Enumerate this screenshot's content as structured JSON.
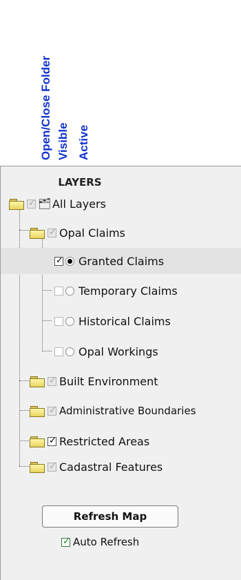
{
  "column_labels": [
    "Open/Close Folder",
    "Visible",
    "Active"
  ],
  "panel": {
    "title": "LAYERS",
    "all_layers": {
      "label": "All Layers",
      "visible": true,
      "visible_greyed": true
    },
    "groups": [
      {
        "label": "Opal Claims",
        "visible": true,
        "children": [
          {
            "label": "Granted Claims",
            "visible": true,
            "active": true,
            "highlighted": true
          },
          {
            "label": "Temporary Claims",
            "visible": false,
            "active": false
          },
          {
            "label": "Historical Claims",
            "visible": false,
            "active": false
          },
          {
            "label": "Opal Workings",
            "visible": false,
            "active": false
          }
        ]
      },
      {
        "label": "Built Environment",
        "visible": true
      },
      {
        "label": "Administrative Boundaries",
        "visible": true
      },
      {
        "label": "Restricted Areas",
        "visible": true
      },
      {
        "label": "Cadastral Features",
        "visible": true
      }
    ],
    "refresh_button": "Refresh Map",
    "auto_refresh": {
      "label": "Auto Refresh",
      "checked": true
    }
  },
  "colors": {
    "column_label": "#1133cc",
    "panel_bg": "#f0f0f0",
    "folder": "#f0dd70"
  }
}
